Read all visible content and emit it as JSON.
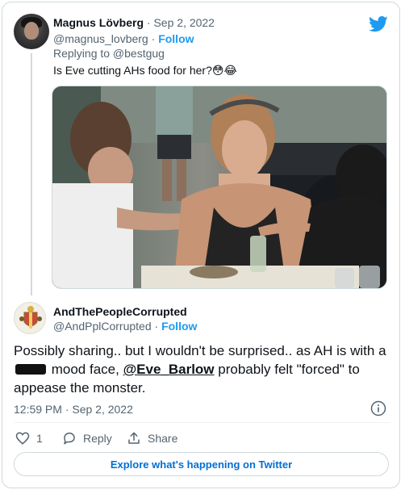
{
  "parent_tweet": {
    "display_name": "Magnus Lövberg",
    "date_meta": " · Sep 2, 2022",
    "handle": "@magnus_lovberg",
    "follow_label": "Follow",
    "replying_to": "Replying to @bestgug",
    "text": "Is Eve cutting AHs food for her?",
    "emojis": "😳😂"
  },
  "reply_tweet": {
    "display_name": "AndThePeopleCorrupted",
    "handle": "@AndPplCorrupted",
    "follow_label": "Follow",
    "text_part1": "Possibly sharing.. but I wouldn't be surprised.. as AH is with a",
    "text_part2": "mood face,",
    "mention": "@Eve_Barlow",
    "text_part3": "probably felt \"forced\"  to appease the monster.",
    "timestamp": "12:59 PM · Sep 2, 2022"
  },
  "actions": {
    "like_count": "1",
    "reply_label": "Reply",
    "share_label": "Share"
  },
  "explore_label": "Explore what's happening on Twitter",
  "icons": {
    "brand": "twitter-bird-icon",
    "info": "info-icon",
    "like": "heart-icon",
    "reply": "reply-bubble-icon",
    "share": "share-upload-icon"
  },
  "colors": {
    "twitter_blue": "#1d9bf0",
    "link_blue": "#006fd6",
    "secondary_text": "#536471",
    "border": "#cfd9de"
  }
}
